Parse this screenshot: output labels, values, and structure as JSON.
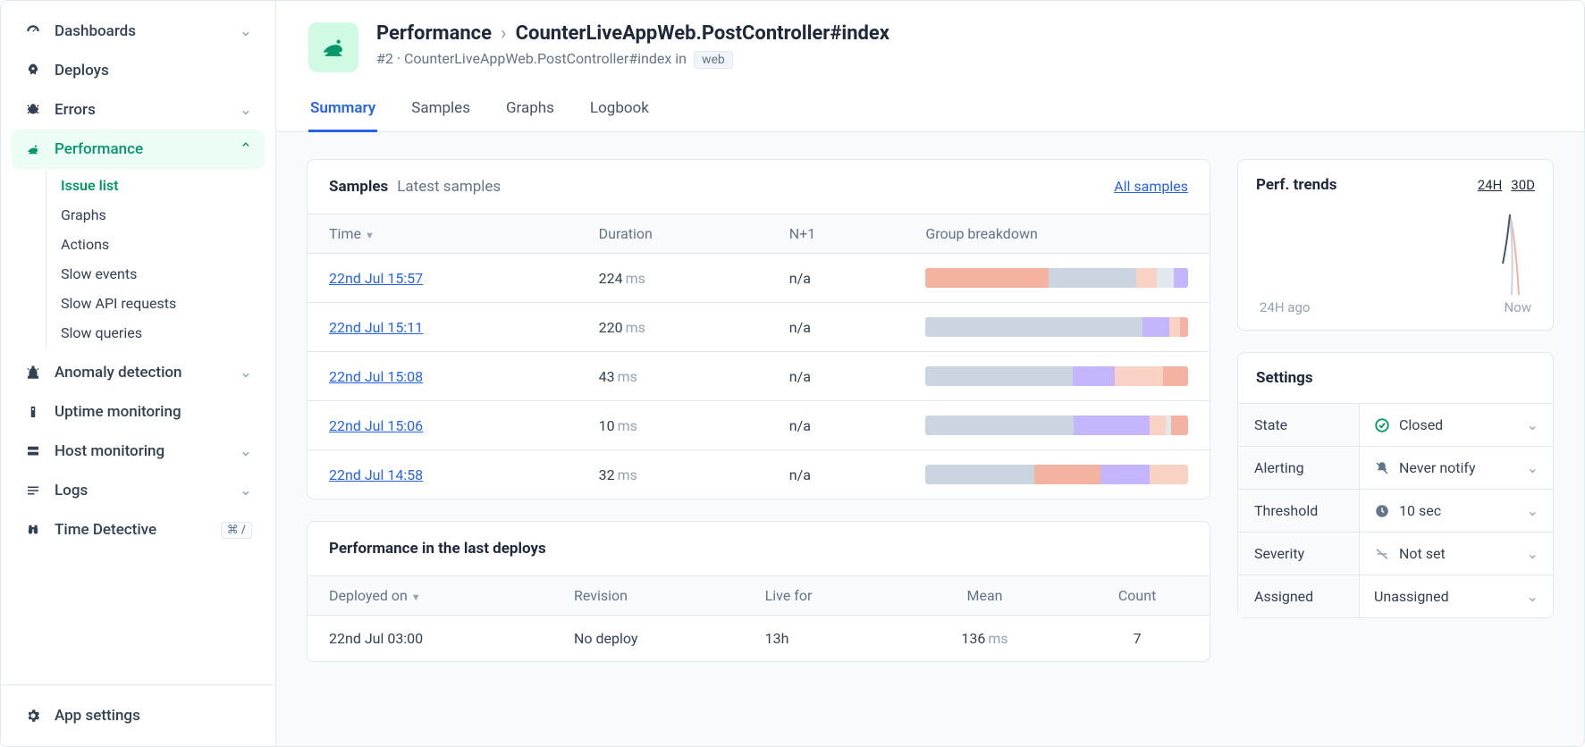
{
  "sidebar": {
    "items": [
      {
        "label": "Dashboards",
        "icon": "dashboard",
        "chev": "down"
      },
      {
        "label": "Deploys",
        "icon": "rocket"
      },
      {
        "label": "Errors",
        "icon": "bug",
        "chev": "down"
      },
      {
        "label": "Performance",
        "icon": "frog",
        "chev": "up",
        "active": true
      },
      {
        "label": "Anomaly detection",
        "icon": "siren",
        "chev": "down"
      },
      {
        "label": "Uptime monitoring",
        "icon": "uptime"
      },
      {
        "label": "Host monitoring",
        "icon": "host",
        "chev": "down"
      },
      {
        "label": "Logs",
        "icon": "logs",
        "chev": "down"
      },
      {
        "label": "Time Detective",
        "icon": "binoculars",
        "kbd": "⌘ /"
      }
    ],
    "sub_performance": [
      {
        "label": "Issue list",
        "active": true
      },
      {
        "label": "Graphs"
      },
      {
        "label": "Actions"
      },
      {
        "label": "Slow events"
      },
      {
        "label": "Slow API requests"
      },
      {
        "label": "Slow queries"
      }
    ],
    "footer": {
      "label": "App settings",
      "icon": "gear"
    }
  },
  "header": {
    "breadcrumb_root": "Performance",
    "breadcrumb_leaf": "CounterLiveAppWeb.PostController#index",
    "sub_prefix": "#2 ·",
    "sub_action": "CounterLiveAppWeb.PostController#index in",
    "sub_badge": "web"
  },
  "tabs": [
    "Summary",
    "Samples",
    "Graphs",
    "Logbook"
  ],
  "active_tab": "Summary",
  "samples": {
    "title": "Samples",
    "subtitle": "Latest samples",
    "link": "All samples",
    "columns": [
      "Time",
      "Duration",
      "N+1",
      "Group breakdown"
    ],
    "rows": [
      {
        "time": "22nd Jul 15:57",
        "dur_val": "224",
        "dur_unit": "ms",
        "n": "n/a",
        "bars": [
          [
            "#f4b2a0",
            46.8
          ],
          [
            "#cbd5e1",
            33.3
          ],
          [
            "#f9d2c4",
            8.1
          ],
          [
            "#e2e8f0",
            6.3
          ],
          [
            "#c4b5fd",
            5.5
          ]
        ]
      },
      {
        "time": "22nd Jul 15:11",
        "dur_val": "220",
        "dur_unit": "ms",
        "n": "n/a",
        "bars": [
          [
            "#cbd5e1",
            82.5
          ],
          [
            "#c4b5fd",
            10.5
          ],
          [
            "#f9d2c4",
            4.0
          ],
          [
            "#f4b2a0",
            3.0
          ]
        ]
      },
      {
        "time": "22nd Jul  15:08",
        "dur_val": "43",
        "dur_unit": "ms",
        "n": "n/a",
        "bars": [
          [
            "#cbd5e1",
            56.0
          ],
          [
            "#c4b5fd",
            16.0
          ],
          [
            "#f9d2c4",
            18.5
          ],
          [
            "#f4b2a0",
            9.5
          ]
        ]
      },
      {
        "time": "22nd Jul 15:06",
        "dur_val": "10",
        "dur_unit": "ms",
        "n": "n/a",
        "bars": [
          [
            "#cbd5e1",
            56.5
          ],
          [
            "#c4b5fd",
            29.0
          ],
          [
            "#f9d2c4",
            6.0
          ],
          [
            "#e2e8f0",
            2.0
          ],
          [
            "#f4b2a0",
            6.5
          ]
        ]
      },
      {
        "time": "22nd Jul 14:58",
        "dur_val": "32",
        "dur_unit": "ms",
        "n": "n/a",
        "bars": [
          [
            "#cbd5e1",
            41.5
          ],
          [
            "#f4b2a0",
            25.0
          ],
          [
            "#c4b5fd",
            19.0
          ],
          [
            "#f9d2c4",
            14.5
          ]
        ]
      }
    ]
  },
  "deploys": {
    "title": "Performance in the last deploys",
    "columns": [
      "Deployed on",
      "Revision",
      "Live for",
      "Mean",
      "Count"
    ],
    "rows": [
      {
        "deployed": "22nd Jul 03:00",
        "revision": "No deploy",
        "live": "13h",
        "mean_val": "136",
        "mean_unit": "ms",
        "count": "7"
      }
    ]
  },
  "trends": {
    "title": "Perf. trends",
    "selectors": [
      "24H",
      "30D"
    ],
    "foot_left": "24H ago",
    "foot_right": "Now"
  },
  "settings": {
    "title": "Settings",
    "rows": [
      {
        "label": "State",
        "value": "Closed",
        "icon": "ok"
      },
      {
        "label": "Alerting",
        "value": "Never notify",
        "icon": "bell-off"
      },
      {
        "label": "Threshold",
        "value": "10 sec",
        "icon": "clock"
      },
      {
        "label": "Severity",
        "value": "Not set",
        "icon": "dash"
      },
      {
        "label": "Assigned",
        "value": "Unassigned",
        "icon": ""
      }
    ]
  },
  "colors": {
    "accent": "#2563eb",
    "brand": "#059669"
  }
}
